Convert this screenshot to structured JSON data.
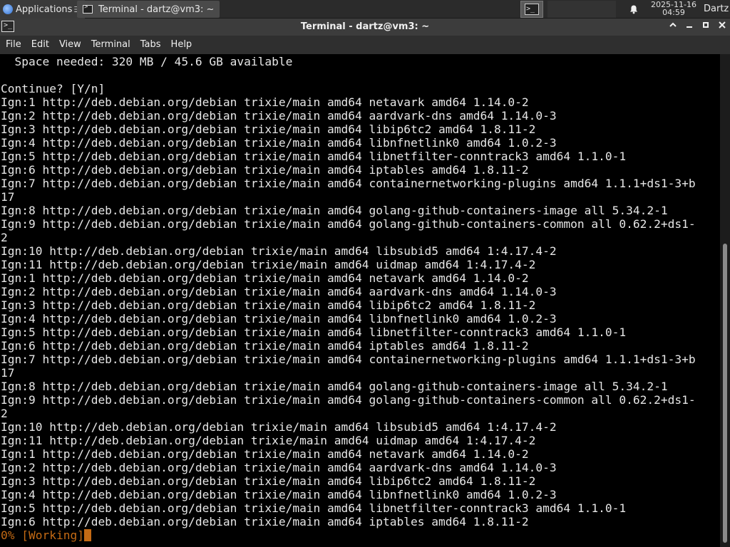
{
  "panel": {
    "apps_label": "Applications",
    "task_label": "Terminal - dartz@vm3: ~",
    "clock_date": "2025-11-16",
    "clock_time": "04:59",
    "user": "Dartz"
  },
  "window": {
    "title": "Terminal - dartz@vm3: ~"
  },
  "menu": {
    "items": [
      "File",
      "Edit",
      "View",
      "Terminal",
      "Tabs",
      "Help"
    ]
  },
  "terminal": {
    "lines": [
      "  Space needed: 320 MB / 45.6 GB available",
      "",
      "Continue? [Y/n]",
      "Ign:1 http://deb.debian.org/debian trixie/main amd64 netavark amd64 1.14.0-2",
      "Ign:2 http://deb.debian.org/debian trixie/main amd64 aardvark-dns amd64 1.14.0-3",
      "Ign:3 http://deb.debian.org/debian trixie/main amd64 libip6tc2 amd64 1.8.11-2",
      "Ign:4 http://deb.debian.org/debian trixie/main amd64 libnfnetlink0 amd64 1.0.2-3",
      "Ign:5 http://deb.debian.org/debian trixie/main amd64 libnetfilter-conntrack3 amd64 1.1.0-1",
      "Ign:6 http://deb.debian.org/debian trixie/main amd64 iptables amd64 1.8.11-2",
      "Ign:7 http://deb.debian.org/debian trixie/main amd64 containernetworking-plugins amd64 1.1.1+ds1-3+b",
      "17",
      "Ign:8 http://deb.debian.org/debian trixie/main amd64 golang-github-containers-image all 5.34.2-1",
      "Ign:9 http://deb.debian.org/debian trixie/main amd64 golang-github-containers-common all 0.62.2+ds1-",
      "2",
      "Ign:10 http://deb.debian.org/debian trixie/main amd64 libsubid5 amd64 1:4.17.4-2",
      "Ign:11 http://deb.debian.org/debian trixie/main amd64 uidmap amd64 1:4.17.4-2",
      "Ign:1 http://deb.debian.org/debian trixie/main amd64 netavark amd64 1.14.0-2",
      "Ign:2 http://deb.debian.org/debian trixie/main amd64 aardvark-dns amd64 1.14.0-3",
      "Ign:3 http://deb.debian.org/debian trixie/main amd64 libip6tc2 amd64 1.8.11-2",
      "Ign:4 http://deb.debian.org/debian trixie/main amd64 libnfnetlink0 amd64 1.0.2-3",
      "Ign:5 http://deb.debian.org/debian trixie/main amd64 libnetfilter-conntrack3 amd64 1.1.0-1",
      "Ign:6 http://deb.debian.org/debian trixie/main amd64 iptables amd64 1.8.11-2",
      "Ign:7 http://deb.debian.org/debian trixie/main amd64 containernetworking-plugins amd64 1.1.1+ds1-3+b",
      "17",
      "Ign:8 http://deb.debian.org/debian trixie/main amd64 golang-github-containers-image all 5.34.2-1",
      "Ign:9 http://deb.debian.org/debian trixie/main amd64 golang-github-containers-common all 0.62.2+ds1-",
      "2",
      "Ign:10 http://deb.debian.org/debian trixie/main amd64 libsubid5 amd64 1:4.17.4-2",
      "Ign:11 http://deb.debian.org/debian trixie/main amd64 uidmap amd64 1:4.17.4-2",
      "Ign:1 http://deb.debian.org/debian trixie/main amd64 netavark amd64 1.14.0-2",
      "Ign:2 http://deb.debian.org/debian trixie/main amd64 aardvark-dns amd64 1.14.0-3",
      "Ign:3 http://deb.debian.org/debian trixie/main amd64 libip6tc2 amd64 1.8.11-2",
      "Ign:4 http://deb.debian.org/debian trixie/main amd64 libnfnetlink0 amd64 1.0.2-3",
      "Ign:5 http://deb.debian.org/debian trixie/main amd64 libnetfilter-conntrack3 amd64 1.1.0-1",
      "Ign:6 http://deb.debian.org/debian trixie/main amd64 iptables amd64 1.8.11-2"
    ],
    "progress_line": "0% [Working]"
  },
  "colors": {
    "progress": "#c46a14",
    "terminal_bg": "#000000",
    "terminal_fg": "#e6e6e6"
  }
}
